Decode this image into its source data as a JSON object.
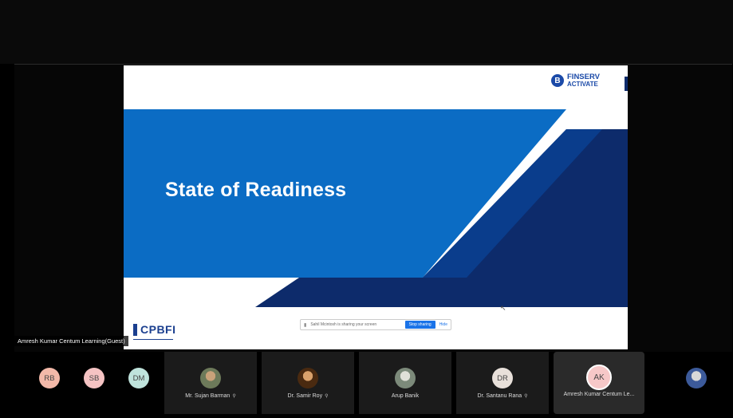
{
  "slide": {
    "title": "State of Readiness",
    "brand_line1": "FINSERV",
    "brand_line2": "ACTIVATE",
    "brand_icon": "B",
    "footer_logo": "CPBFI",
    "colors": {
      "primary_blue": "#0b6cc4",
      "navy": "#0d2b6b",
      "brand": "#1b4aa8"
    }
  },
  "share_bar": {
    "message": "Sahil Mcintosh is sharing your screen",
    "stop_label": "Stop sharing",
    "hide_label": "Hide"
  },
  "presenter_label": "Amresh Kumar Centum Learning(Guest)",
  "participants": [
    {
      "initials": "RB",
      "color": "#f3b9a9"
    },
    {
      "initials": "SB",
      "color": "#f5c3c3"
    },
    {
      "initials": "DM",
      "color": "#bfe3dc"
    },
    {
      "name": "Mr. Sujan Barman",
      "photo_color": "#6d7a5a"
    },
    {
      "name": "Dr. Samir Roy",
      "photo_color": "#8a5a2b"
    },
    {
      "name": "Arup Banik",
      "photo_color": "#7c8a7a"
    },
    {
      "initials": "DR",
      "name": "Dr. Santanu Rana",
      "color": "#e8e0da"
    },
    {
      "initials": "AK",
      "name": "Amresh Kumar Centum Le..."
    },
    {
      "photo_color": "#3c5a9a"
    }
  ]
}
